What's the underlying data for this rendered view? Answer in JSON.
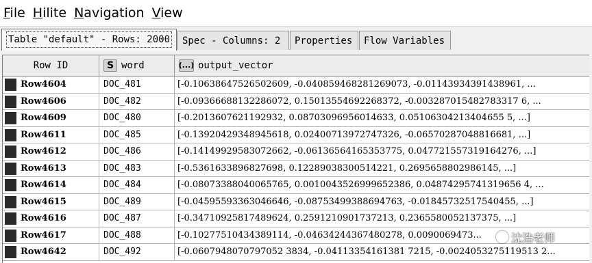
{
  "menu": [
    {
      "pre": "",
      "ul": "F",
      "post": "ile"
    },
    {
      "pre": "",
      "ul": "H",
      "post": "ilite"
    },
    {
      "pre": "",
      "ul": "N",
      "post": "avigation"
    },
    {
      "pre": "",
      "ul": "V",
      "post": "iew"
    }
  ],
  "tabs": {
    "table": "Table \"default\" - Rows: 2000",
    "spec": "Spec - Columns: 2",
    "properties": "Properties",
    "flow": "Flow Variables"
  },
  "columns": {
    "row_id": "Row ID",
    "word_type": "S",
    "word": "word",
    "vector_type": "(...)",
    "vector": "output_vector"
  },
  "rows": [
    {
      "id": "Row4604",
      "word": "DOC_481",
      "vector": "[-0.10638647526502609, -0.040859468281269073, -0.01143934391438961, ..."
    },
    {
      "id": "Row4606",
      "word": "DOC_482",
      "vector": "[-0.09366688132286072, 0.15013554692268372, -0.003287015482783317 6, ..."
    },
    {
      "id": "Row4609",
      "word": "DOC_480",
      "vector": "[-0.2013607621192932, 0.08703096956014633, 0.05106304213404655 5, ...]"
    },
    {
      "id": "Row4611",
      "word": "DOC_485",
      "vector": "[-0.13920429348945618, 0.02400713972747326, -0.06570287048816681, ...]"
    },
    {
      "id": "Row4612",
      "word": "DOC_486",
      "vector": "[-0.14149929583072662, -0.06136564165353775, 0.047721557319164276, ...]"
    },
    {
      "id": "Row4613",
      "word": "DOC_483",
      "vector": "[-0.5361633896827698, 0.12289038300514221, 0.2695658802986145, ...]"
    },
    {
      "id": "Row4614",
      "word": "DOC_484",
      "vector": "[-0.08073388040065765, 0.0010043526999652386, 0.04874295741319656 4, ..."
    },
    {
      "id": "Row4615",
      "word": "DOC_489",
      "vector": "[-0.04595593363046646, -0.08753499388694763, -0.01845732517540455, ...]"
    },
    {
      "id": "Row4616",
      "word": "DOC_487",
      "vector": "[-0.34710925817489624, 0.2591210901737213, 0.2365580052137375, ...]"
    },
    {
      "id": "Row4617",
      "word": "DOC_488",
      "vector": "[-0.10277510434389114, -0.04634244367480278, 0.0090069473..."
    },
    {
      "id": "Row4642",
      "word": "DOC_492",
      "vector": "[-0.0607948070797052 3834, -0.04113354161381 7215, -0.0024053275119513 2..."
    }
  ],
  "watermark": "沈浩老师"
}
